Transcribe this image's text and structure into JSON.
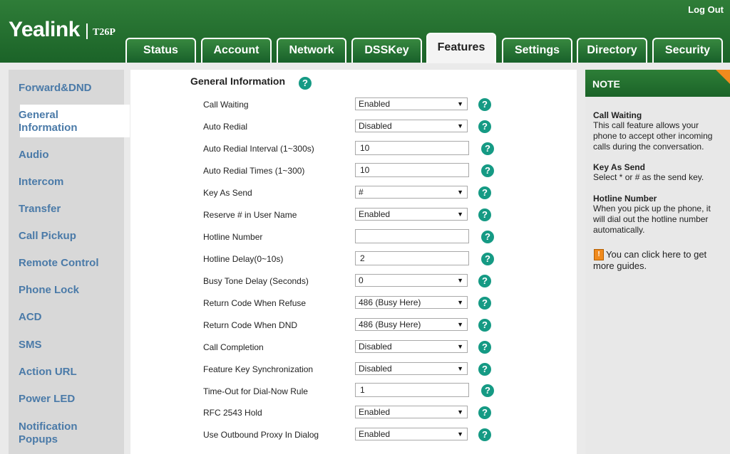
{
  "header": {
    "brand": "Yealink",
    "model": "T26P",
    "logout": "Log Out",
    "tabs": [
      "Status",
      "Account",
      "Network",
      "DSSKey",
      "Features",
      "Settings",
      "Directory",
      "Security"
    ],
    "active_tab": "Features"
  },
  "sidebar": {
    "items": [
      "Forward&DND",
      "General Information",
      "Audio",
      "Intercom",
      "Transfer",
      "Call Pickup",
      "Remote Control",
      "Phone Lock",
      "ACD",
      "SMS",
      "Action URL",
      "Power LED",
      "Notification Popups"
    ],
    "active": "General Information"
  },
  "main": {
    "title": "General Information",
    "rows": [
      {
        "label": "Call Waiting",
        "type": "select",
        "value": "Enabled"
      },
      {
        "label": "Auto Redial",
        "type": "select",
        "value": "Disabled"
      },
      {
        "label": "Auto Redial Interval (1~300s)",
        "type": "input",
        "value": "10"
      },
      {
        "label": "Auto Redial Times (1~300)",
        "type": "input",
        "value": "10"
      },
      {
        "label": "Key As Send",
        "type": "select",
        "value": "#"
      },
      {
        "label": "Reserve # in User Name",
        "type": "select",
        "value": "Enabled"
      },
      {
        "label": "Hotline Number",
        "type": "input",
        "value": ""
      },
      {
        "label": "Hotline Delay(0~10s)",
        "type": "input",
        "value": "2"
      },
      {
        "label": "Busy Tone Delay (Seconds)",
        "type": "select",
        "value": "0"
      },
      {
        "label": "Return Code When Refuse",
        "type": "select",
        "value": "486 (Busy Here)"
      },
      {
        "label": "Return Code When DND",
        "type": "select",
        "value": "486 (Busy Here)"
      },
      {
        "label": "Call Completion",
        "type": "select",
        "value": "Disabled"
      },
      {
        "label": "Feature Key Synchronization",
        "type": "select",
        "value": "Disabled"
      },
      {
        "label": "Time-Out for Dial-Now Rule",
        "type": "input",
        "value": "1"
      },
      {
        "label": "RFC 2543 Hold",
        "type": "select",
        "value": "Enabled"
      },
      {
        "label": "Use Outbound Proxy In Dialog",
        "type": "select",
        "value": "Enabled"
      }
    ]
  },
  "note": {
    "title": "NOTE",
    "sections": [
      {
        "heading": "Call Waiting",
        "text": "This call feature allows your phone to accept other incoming calls during the conversation."
      },
      {
        "heading": "Key As Send",
        "text": "Select * or # as the send key."
      },
      {
        "heading": "Hotline Number",
        "text": "When you pick up the phone, it will dial out the hotline number automatically."
      }
    ],
    "guide": "You can click here to get more guides."
  },
  "colors": {
    "header_green": "#1b6328",
    "accent_orange": "#f08a1d",
    "help_teal": "#159a84",
    "sidebar_link": "#4a7aa8"
  }
}
